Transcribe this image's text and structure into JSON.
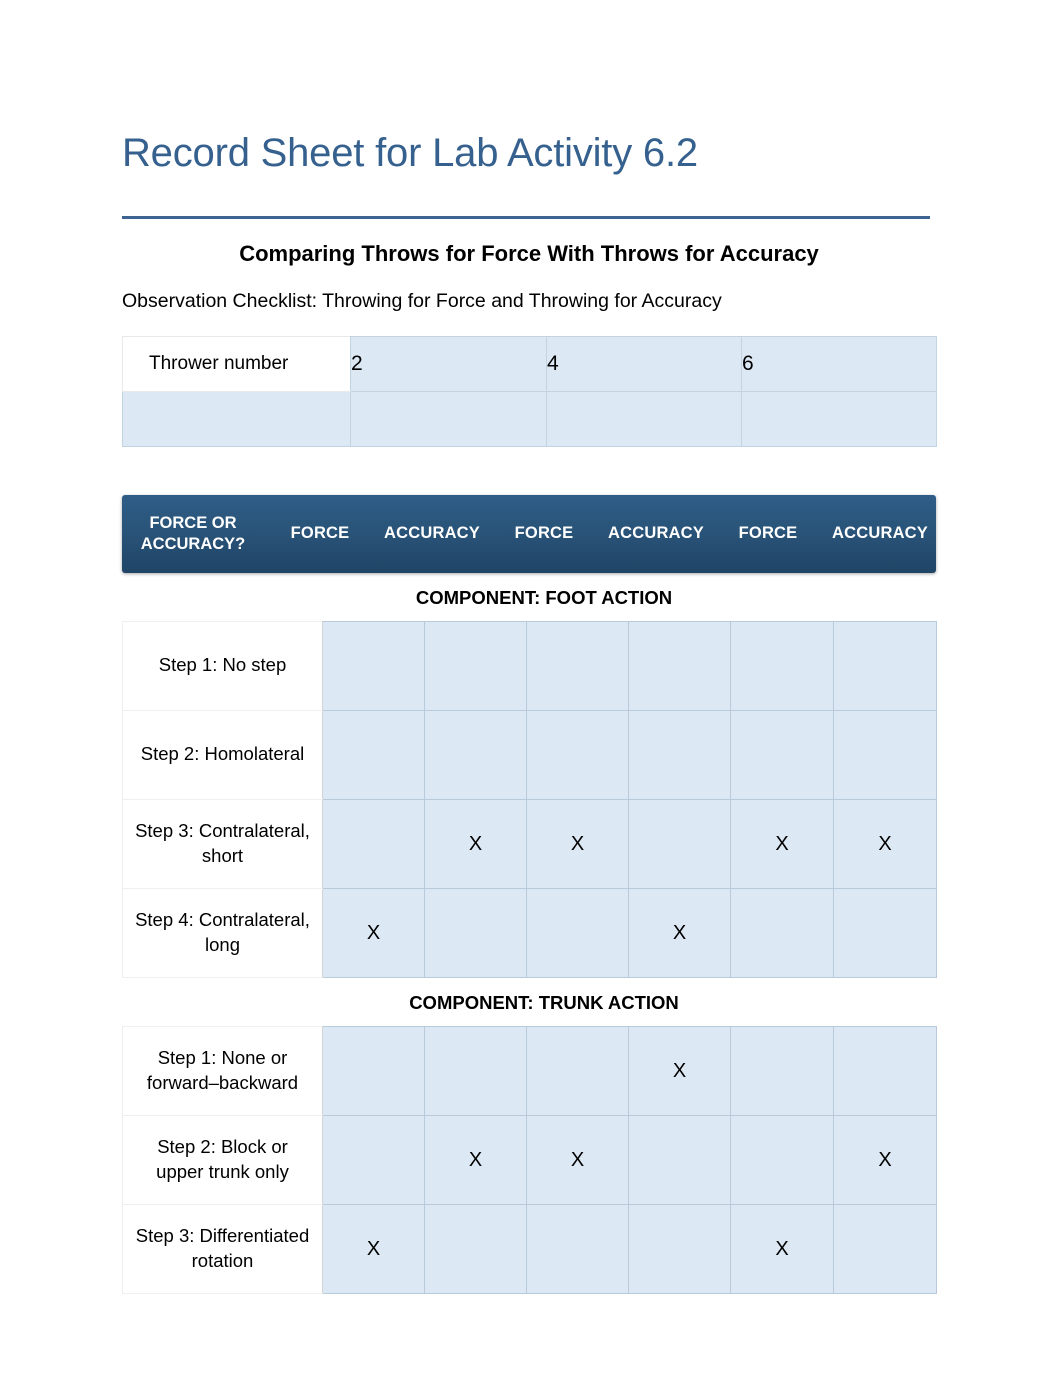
{
  "document": {
    "title": "Record Sheet for Lab Activity 6.2",
    "subtitle": "Comparing Throws for Force With Throws for Accuracy",
    "checklist_line": "Observation Checklist: Throwing for Force and Throwing for Accuracy",
    "accent_color": "#36618e",
    "band_color": "#2a5479",
    "cell_color": "#dce8f3"
  },
  "thrower_table": {
    "label": "Thrower number",
    "numbers": [
      "2",
      "4",
      "6"
    ],
    "blank_row": [
      "",
      "",
      "",
      ""
    ]
  },
  "band": {
    "label_line1": "FORCE OR",
    "label_line2": "ACCURACY?",
    "columns": [
      "FORCE",
      "ACCURACY",
      "FORCE",
      "ACCURACY",
      "FORCE",
      "ACCURACY"
    ]
  },
  "mark": "X",
  "sections": [
    {
      "heading": "COMPONENT: FOOT ACTION",
      "rows": [
        {
          "label": "Step 1: No step",
          "marks": [
            "",
            "",
            "",
            "",
            "",
            ""
          ]
        },
        {
          "label": "Step 2: Homolateral",
          "marks": [
            "",
            "",
            "",
            "",
            "",
            ""
          ]
        },
        {
          "label": "Step 3: Contralateral, short",
          "marks": [
            "",
            "X",
            "X",
            "",
            "X",
            "X"
          ]
        },
        {
          "label": "Step 4: Contralateral, long",
          "marks": [
            "X",
            "",
            "",
            "X",
            "",
            ""
          ]
        }
      ]
    },
    {
      "heading": "COMPONENT: TRUNK ACTION",
      "rows": [
        {
          "label": "Step 1: None or forward–backward",
          "marks": [
            "",
            "",
            "",
            "X",
            "",
            ""
          ]
        },
        {
          "label": "Step 2: Block or upper trunk only",
          "marks": [
            "",
            "X",
            "X",
            "",
            "",
            "X"
          ]
        },
        {
          "label": "Step 3: Differentiated rotation",
          "marks": [
            "X",
            "",
            "",
            "",
            "X",
            ""
          ]
        }
      ]
    }
  ]
}
